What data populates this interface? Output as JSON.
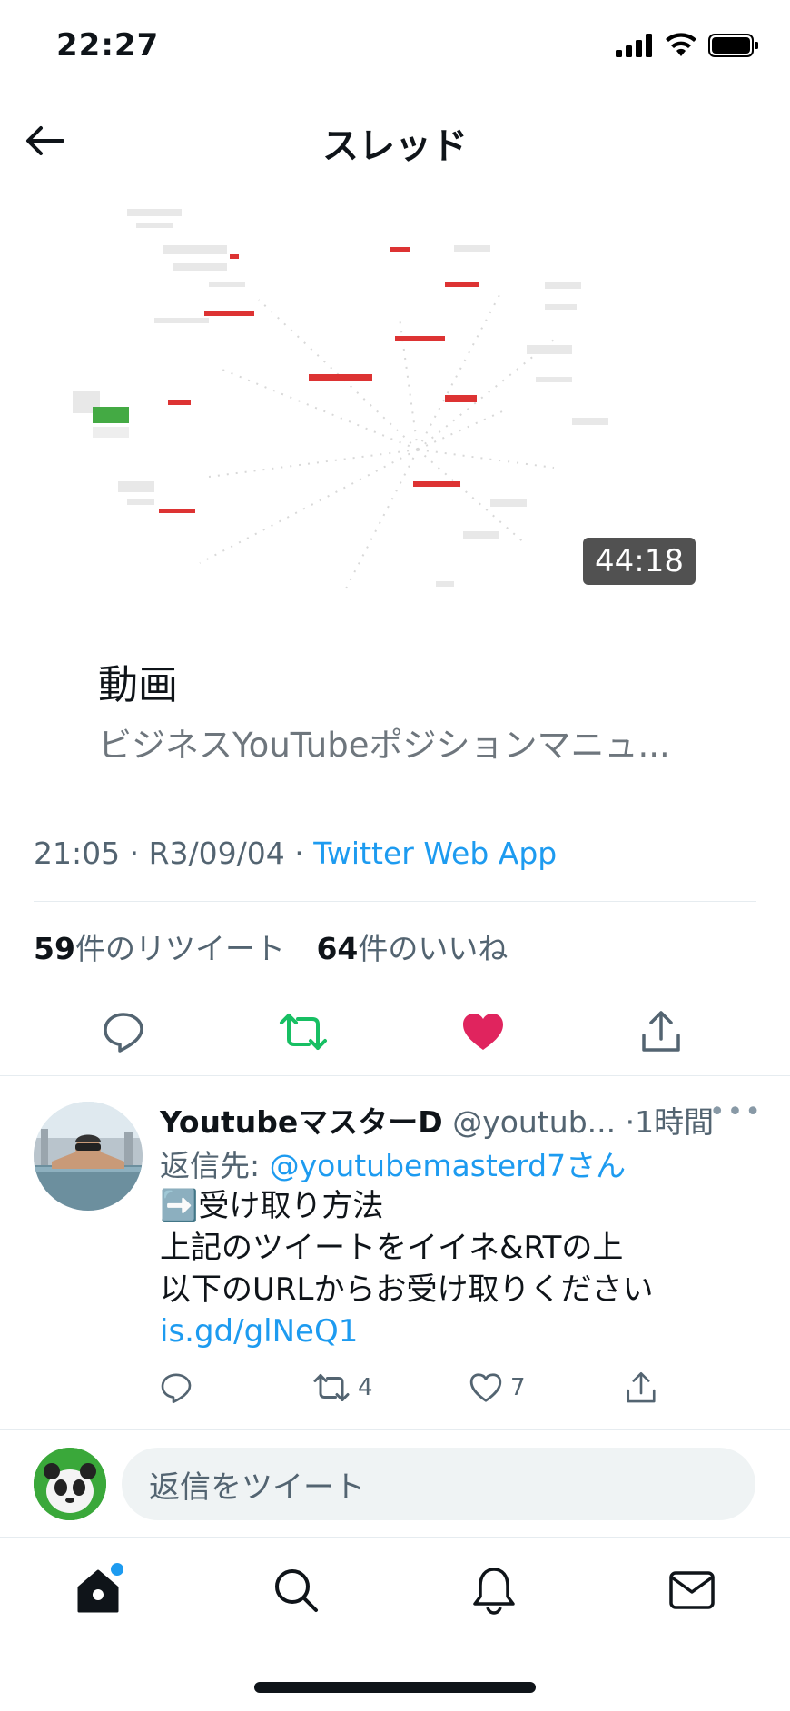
{
  "status_bar": {
    "time": "22:27"
  },
  "nav": {
    "title": "スレッド"
  },
  "media": {
    "duration": "44:18",
    "title": "動画",
    "description": "ビジネスYouTubeポジションマニュ..."
  },
  "tweet_meta": {
    "time": "21:05",
    "separator": " · ",
    "date": "R3/09/04",
    "source": "Twitter Web App"
  },
  "stats": {
    "retweet_count": "59",
    "retweet_label": "件のリツイート",
    "like_count": "64",
    "like_label": "件のいいね"
  },
  "actions": {
    "reply_icon": "reply-icon",
    "retweet_icon": "retweet-icon",
    "like_icon": "heart-icon",
    "share_icon": "share-icon",
    "retweet_color": "#17bf63",
    "like_color": "#e0245e"
  },
  "reply": {
    "name": "YoutubeマスターD",
    "handle": "@youtub...",
    "time": "·1時間",
    "more": "•••",
    "reply_to_label": "返信先: ",
    "reply_to_mention": "@youtubemasterd7さん",
    "line1": "➡️受け取り方法",
    "line2": "上記のツイートをイイネ&RTの上",
    "line3": "以下のURLからお受け取りください",
    "link": "is.gd/glNeQ1",
    "retweets": "4",
    "likes": "7"
  },
  "compose": {
    "placeholder": "返信をツイート"
  },
  "accent": "#1d9bf0"
}
